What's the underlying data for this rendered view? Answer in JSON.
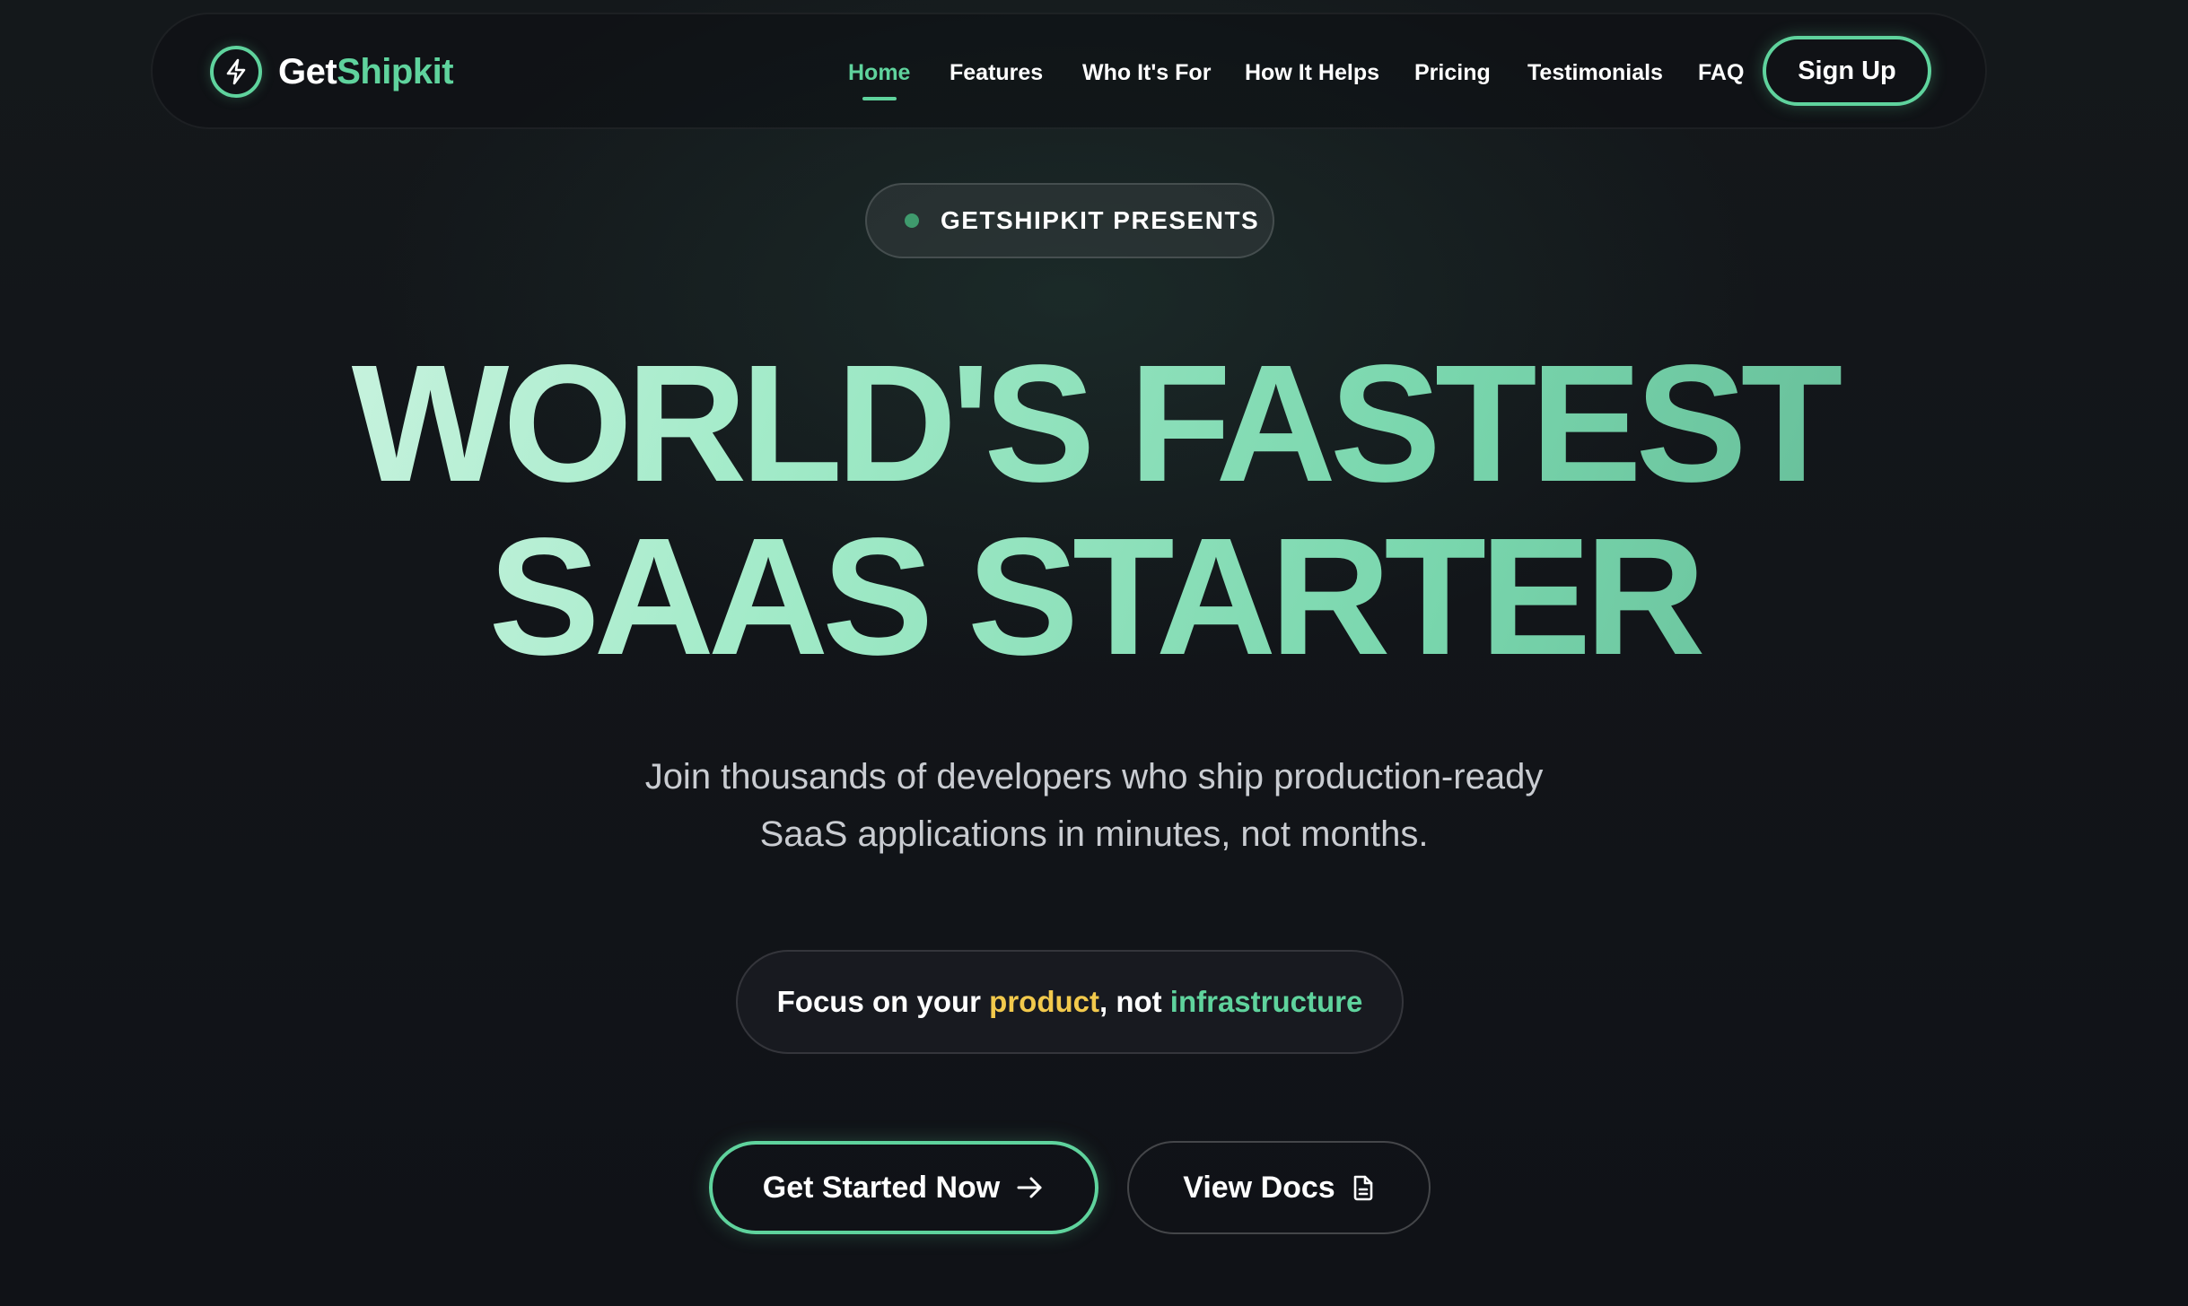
{
  "colors": {
    "accent": "#5fd39d",
    "highlight_yellow": "#f2c94c",
    "background": "#111318"
  },
  "navbar": {
    "brand": {
      "logo_icon": "lightning-bolt-icon",
      "name_part1": "Get",
      "name_part2": "Shipkit"
    },
    "links": [
      {
        "label": "Home",
        "active": true
      },
      {
        "label": "Features",
        "active": false
      },
      {
        "label": "Who It's For",
        "active": false
      },
      {
        "label": "How It Helps",
        "active": false
      },
      {
        "label": "Pricing",
        "active": false
      },
      {
        "label": "Testimonials",
        "active": false
      },
      {
        "label": "FAQ",
        "active": false
      }
    ],
    "signup_label": "Sign Up"
  },
  "hero": {
    "badge": "GETSHIPKIT PRESENTS",
    "headline_line1": "WORLD'S FASTEST",
    "headline_line2": "SAAS STARTER",
    "subtext_line1": "Join thousands of developers who ship production-ready",
    "subtext_line2": "SaaS applications in minutes, not months.",
    "focus": {
      "part1": "Focus on your ",
      "part2": "product",
      "part3": ", not ",
      "part4": "infrastructure"
    },
    "cta_primary": {
      "label": "Get Started Now",
      "icon": "arrow-right-icon"
    },
    "cta_secondary": {
      "label": "View Docs",
      "icon": "document-icon"
    }
  }
}
